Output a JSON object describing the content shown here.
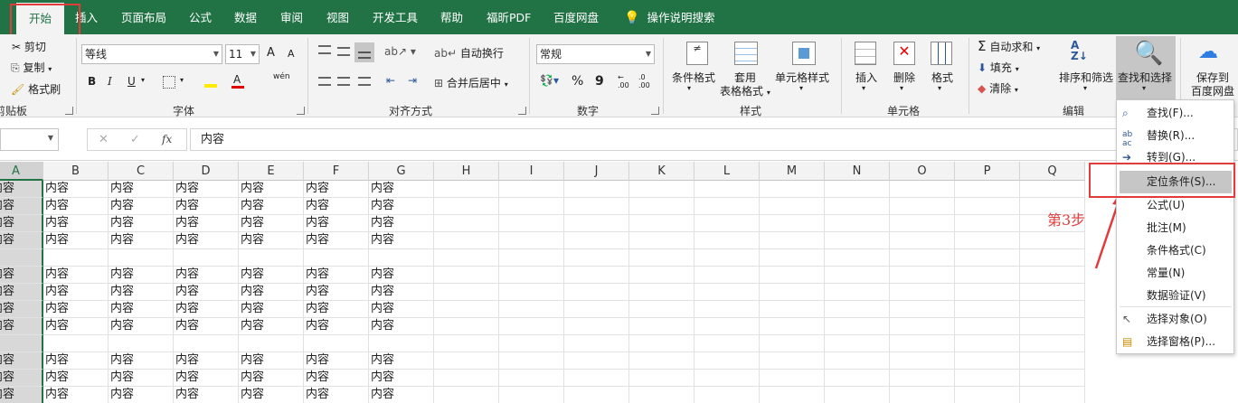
{
  "tabs": [
    {
      "label": "开始",
      "active": true
    },
    {
      "label": "插入"
    },
    {
      "label": "页面布局"
    },
    {
      "label": "公式"
    },
    {
      "label": "数据"
    },
    {
      "label": "审阅"
    },
    {
      "label": "视图"
    },
    {
      "label": "开发工具"
    },
    {
      "label": "帮助"
    },
    {
      "label": "福昕PDF"
    },
    {
      "label": "百度网盘"
    },
    {
      "label": "操作说明搜索"
    }
  ],
  "clipboard": {
    "cut": "剪切",
    "copy": "复制",
    "format_painter": "格式刷",
    "label": "剪贴板"
  },
  "font": {
    "name": "等线",
    "size": "11",
    "grow": "A",
    "shrink": "A",
    "bold": "B",
    "italic": "I",
    "underline": "U",
    "phonetic": "wén",
    "label": "字体"
  },
  "alignment": {
    "wrap": "自动换行",
    "merge": "合并后居中",
    "label": "对齐方式"
  },
  "number": {
    "format": "常规",
    "percent": "%",
    "comma": "9",
    "inc_decimal": ".00",
    "dec_decimal": ".00",
    "label": "数字"
  },
  "styles": {
    "conditional": "条件格式",
    "table_line1": "套用",
    "table_line2": "表格格式",
    "cell_styles": "单元格样式",
    "label": "样式"
  },
  "cells": {
    "insert": "插入",
    "delete": "删除",
    "format": "格式",
    "label": "单元格"
  },
  "editing": {
    "autosum": "自动求和",
    "fill": "填充",
    "clear": "清除",
    "sort": "排序和筛选",
    "find": "查找和选择",
    "label": "编辑"
  },
  "save": {
    "line1": "保存到",
    "line2": "百度网盘"
  },
  "formula_bar": {
    "fx": "fx",
    "value": "内容"
  },
  "columns": [
    "A",
    "B",
    "C",
    "D",
    "E",
    "F",
    "G",
    "H",
    "I",
    "J",
    "K",
    "L",
    "M",
    "N",
    "O",
    "P",
    "Q"
  ],
  "cell_text": "内容",
  "row_pattern": [
    true,
    true,
    true,
    true,
    false,
    true,
    true,
    true,
    true,
    false,
    true,
    true,
    true
  ],
  "dropdown": [
    {
      "label": "查找(F)...",
      "icon": "search-icon"
    },
    {
      "label": "替换(R)...",
      "icon": "replace-icon"
    },
    {
      "label": "转到(G)...",
      "icon": "arrow-right-icon"
    },
    {
      "label": "定位条件(S)...",
      "highlighted": true
    },
    {
      "label": "公式(U)"
    },
    {
      "label": "批注(M)"
    },
    {
      "label": "条件格式(C)"
    },
    {
      "label": "常量(N)"
    },
    {
      "label": "数据验证(V)"
    },
    {
      "label": "选择对象(O)",
      "icon": "pointer-icon"
    },
    {
      "label": "选择窗格(P)...",
      "icon": "selection-pane-icon"
    }
  ],
  "annotation": {
    "step": "第3步",
    "color": "#e03c3c"
  },
  "colors": {
    "brand": "#217346",
    "ribbon": "#f3f3f3",
    "highlight": "#c6c6c6"
  }
}
